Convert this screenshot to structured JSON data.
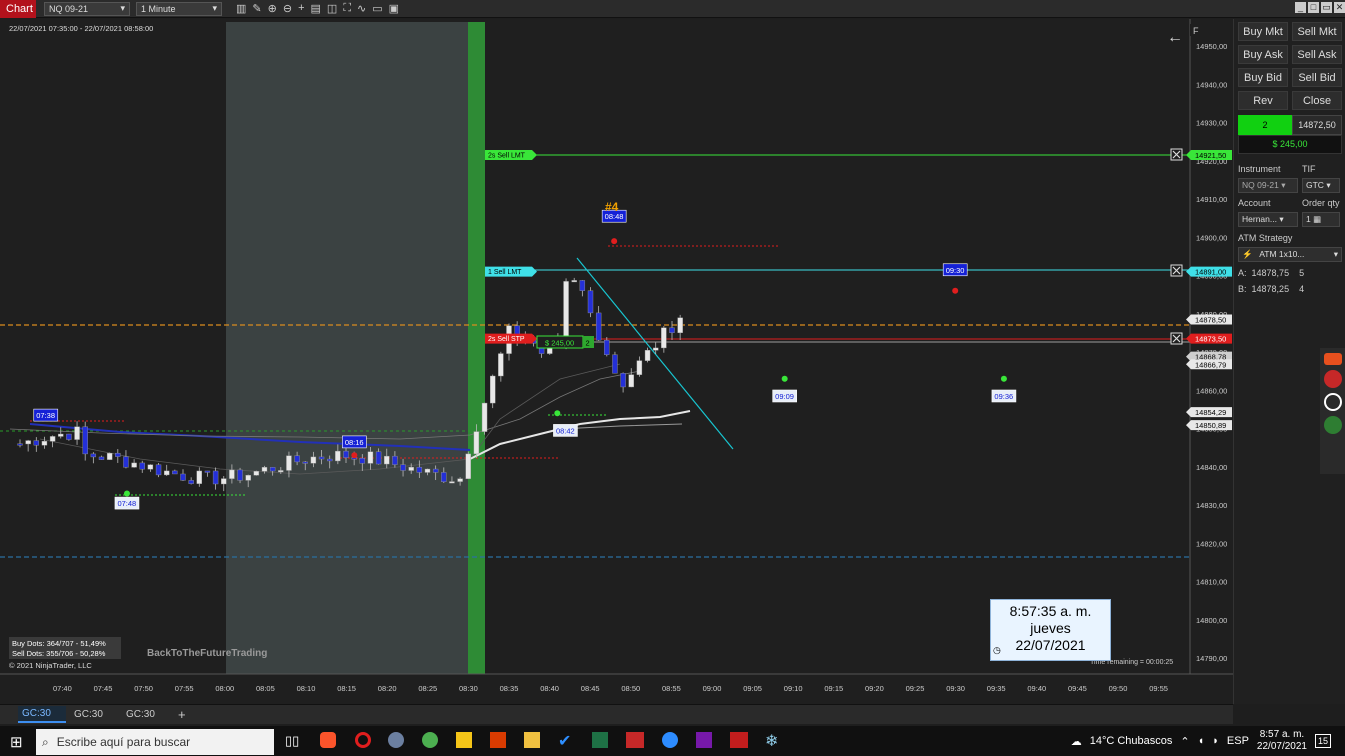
{
  "top": {
    "tab_label": "Chart",
    "instrument": "NQ 09-21",
    "interval": "1 Minute",
    "window_buttons": [
      "_",
      "□",
      "▭",
      "✕"
    ]
  },
  "chart": {
    "date_range": "22/07/2021 07:35:00 - 22/07/2021 08:58:00",
    "f_label": "F",
    "watermark": "BackToTheFutureTrading",
    "copyright": "© 2021 NinjaTrader, LLC",
    "buy_dots": "Buy Dots: 364/707 - 51,49%",
    "sell_dots": "Sell Dots: 355/706 - 50,28%",
    "time_remaining": "Time remaining = 00:00:25",
    "signal_label": "#4",
    "price_axis": [
      "14950,00",
      "14940,00",
      "14930,00",
      "14920,00",
      "14910,00",
      "14900,00",
      "14890,00",
      "14880,00",
      "14870,00",
      "14860,00",
      "14850,00",
      "14840,00",
      "14830,00",
      "14820,00",
      "14810,00",
      "14800,00",
      "14790,00"
    ],
    "time_axis": [
      "07:40",
      "07:45",
      "07:50",
      "07:55",
      "08:00",
      "08:05",
      "08:10",
      "08:15",
      "08:20",
      "08:25",
      "08:30",
      "08:35",
      "08:40",
      "08:45",
      "08:50",
      "08:55",
      "09:00",
      "09:05",
      "09:10",
      "09:15",
      "09:20",
      "09:25",
      "09:30",
      "09:35",
      "09:40",
      "09:45",
      "09:50",
      "09:55"
    ],
    "price_tags": [
      {
        "text": "14921,50",
        "color": "#39e639",
        "fg": "#000",
        "price": 14921.5
      },
      {
        "text": "14891,00",
        "color": "#3fe0e8",
        "fg": "#000",
        "price": 14891
      },
      {
        "text": "14878,50",
        "color": "#e8e8e8",
        "fg": "#000",
        "price": 14878.5
      },
      {
        "text": "14873,50",
        "color": "#e01e1e",
        "fg": "#fff",
        "price": 14873.5
      },
      {
        "text": "14868,78",
        "color": "#cfcfcf",
        "fg": "#000",
        "price": 14868.78
      },
      {
        "text": "14866,79",
        "color": "#e8e8e8",
        "fg": "#000",
        "price": 14866.79
      },
      {
        "text": "14854,29",
        "color": "#e8e8e8",
        "fg": "#000",
        "price": 14854.29
      },
      {
        "text": "14850,89",
        "color": "#e8e8e8",
        "fg": "#000",
        "price": 14850.89
      }
    ],
    "orders": [
      {
        "text": "2s  Sell LMT",
        "color": "#39e639",
        "fg": "#000",
        "price": 14921.5
      },
      {
        "text": "1  Sell LMT",
        "color": "#3fe0e8",
        "fg": "#000",
        "price": 14891
      },
      {
        "text": "2s  Sell STP",
        "color": "#e01e1e",
        "fg": "#fff",
        "price": 14873.5
      }
    ],
    "position": {
      "pnl": "$ 245,00",
      "qty": "2"
    },
    "time_labels": [
      {
        "text": "07:38",
        "style": "blue",
        "time": "07:38",
        "price": 14853.5
      },
      {
        "text": "07:48",
        "style": "white",
        "time": "07:48",
        "price": 14830.5
      },
      {
        "text": "08:16",
        "style": "blue",
        "time": "08:16",
        "price": 14846.5
      },
      {
        "text": "08:42",
        "style": "white",
        "time": "08:42",
        "price": 14849.5
      },
      {
        "text": "08:48",
        "style": "blue",
        "time": "08:48",
        "price": 14905.5
      },
      {
        "text": "09:09",
        "style": "white",
        "time": "09:09",
        "price": 14858.5
      },
      {
        "text": "09:30",
        "style": "blue",
        "time": "09:30",
        "price": 14891.5
      },
      {
        "text": "09:36",
        "style": "white",
        "time": "09:36",
        "price": 14858.5
      }
    ],
    "dots": [
      {
        "color": "#e01e1e",
        "time": "07:39",
        "price": 14853
      },
      {
        "color": "#39e639",
        "time": "07:48",
        "price": 14833
      },
      {
        "color": "#e01e1e",
        "time": "08:16",
        "price": 14843
      },
      {
        "color": "#39e639",
        "time": "08:41",
        "price": 14854
      },
      {
        "color": "#e01e1e",
        "time": "08:48",
        "price": 14899
      },
      {
        "color": "#39e639",
        "time": "09:09",
        "price": 14863
      },
      {
        "color": "#e01e1e",
        "time": "09:30",
        "price": 14886
      },
      {
        "color": "#39e639",
        "time": "09:36",
        "price": 14863
      }
    ]
  },
  "clock": {
    "time": "8:57:35 a. m.",
    "day": "jueves",
    "date": "22/07/2021"
  },
  "panel": {
    "buttons": [
      "Buy Mkt",
      "Sell Mkt",
      "Buy Ask",
      "Sell Ask",
      "Buy Bid",
      "Sell Bid",
      "Rev",
      "Close"
    ],
    "qty": "2",
    "price": "14872,50",
    "pnl": "$ 245,00",
    "instrument_label": "Instrument",
    "tif_label": "TIF",
    "instrument_value": "NQ 09-21",
    "tif_value": "GTC",
    "account_label": "Account",
    "orderqty_label": "Order qty",
    "account_value": "Hernan...",
    "orderqty_value": "1",
    "atm_label": "ATM Strategy",
    "atm_value": "ATM 1x10...",
    "ask_line": {
      "label": "A:",
      "price": "14878,75",
      "size": "5"
    },
    "bid_line": {
      "label": "B:",
      "price": "14878,25",
      "size": "4"
    }
  },
  "chart_tabs": [
    "GC:30",
    "GC:30",
    "GC:30"
  ],
  "add_tab": "+",
  "taskbar": {
    "search_placeholder": "Escribe aquí para buscar",
    "weather": "14°C  Chubascos",
    "lang": "ESP",
    "time": "8:57 a. m.",
    "date": "22/07/2021",
    "notif": "15"
  }
}
